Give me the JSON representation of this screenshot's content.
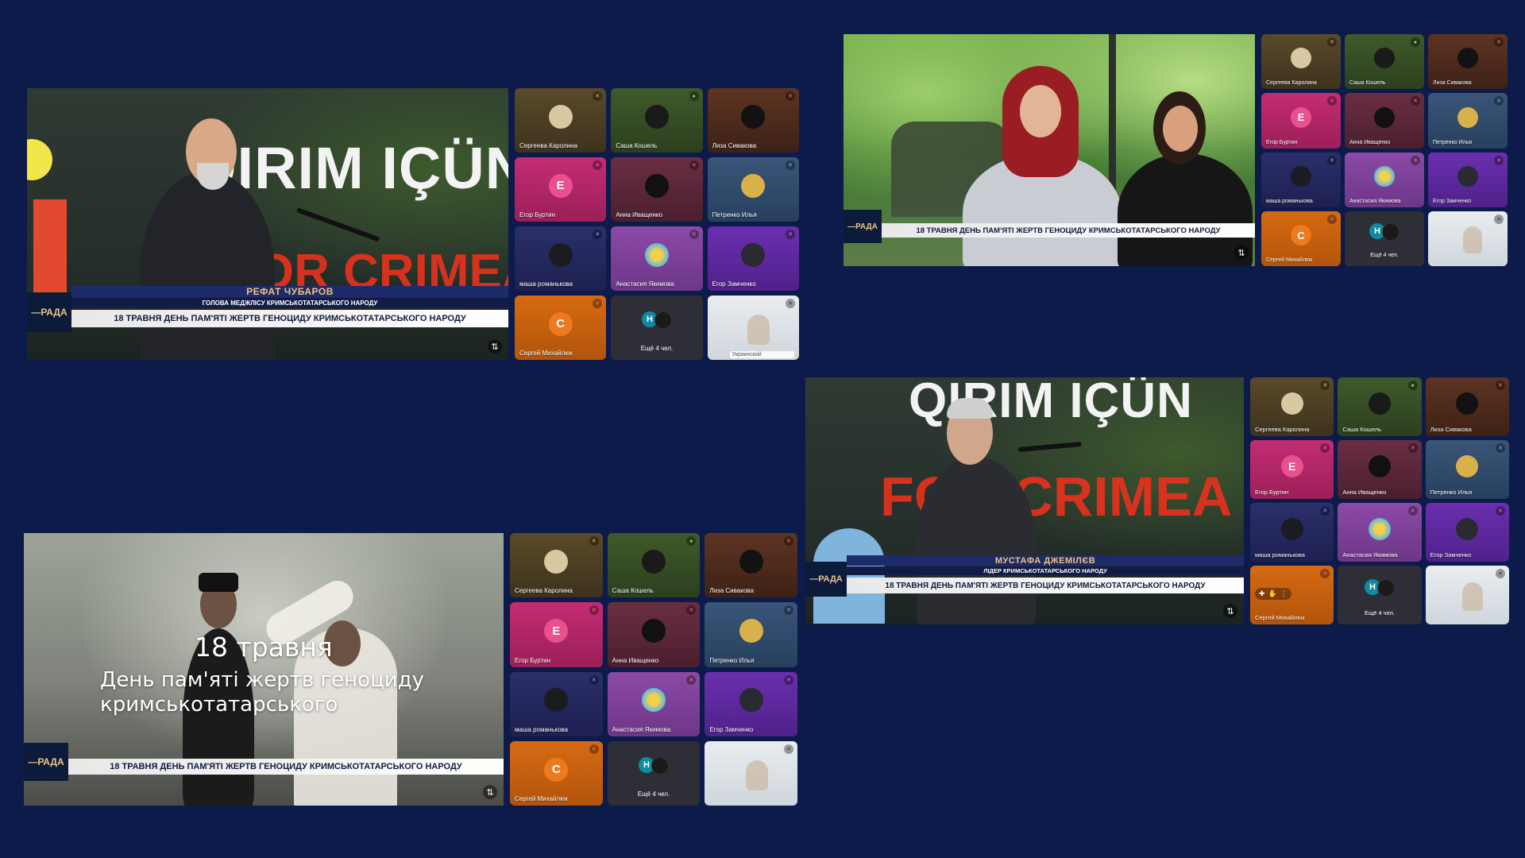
{
  "banner": "18 ТРАВНЯ ДЕНЬ ПАМ'ЯТІ ЖЕРТВ ГЕНОЦИДУ КРИМСЬКОТАТАРСЬКОГО НАРОДУ",
  "channel_logo": "—РАДА",
  "stage_slogan": "QIRIM IÇÜN",
  "stage_slogan2": "FOR CRIMEA",
  "shot1": {
    "speaker_name": "РЕФАТ ЧУБАРОВ",
    "speaker_role": "ГОЛОВА МЕДЖЛІСУ КРИМСЬКОТАТАРСЬКОГО НАРОДУ"
  },
  "shot3": {
    "speaker_name": "МУСТАФА ДЖЕМІЛЄВ",
    "speaker_role": "ЛІДЕР КРИМСЬКОТАТАРСЬКОГО НАРОДУ"
  },
  "shot4": {
    "title_line1": "18 травня",
    "title_line2": "День пам'яті жертв геноциду",
    "title_line3": "кримськотатарського"
  },
  "participants": [
    {
      "name": "Сергеева Каролина",
      "avatar": "photo",
      "style": "t-brown",
      "mic": "muted-yellow"
    },
    {
      "name": "Саша Кошель",
      "avatar": "photo",
      "style": "t-olive",
      "mic": "on"
    },
    {
      "name": "Лиза Сивакова",
      "avatar": "photo",
      "style": "t-rust",
      "mic": "muted"
    },
    {
      "name": "Егор Буртин",
      "avatar": "E",
      "style": "t-pink",
      "mic": "muted"
    },
    {
      "name": "Анна Иващенко",
      "avatar": "photo",
      "style": "t-wine",
      "mic": "muted"
    },
    {
      "name": "Петренко Илья",
      "avatar": "photo",
      "style": "t-steel",
      "mic": "blue"
    },
    {
      "name": "маша романькова",
      "avatar": "photo",
      "style": "t-navy",
      "mic": "blue"
    },
    {
      "name": "Анастасия Якимова",
      "avatar": "photo",
      "style": "t-violet",
      "mic": "muted"
    },
    {
      "name": "Егор Замченко",
      "avatar": "photo",
      "style": "t-purple",
      "mic": "muted"
    },
    {
      "name": "Сергей Михайлюк",
      "avatar": "C",
      "style": "t-orange",
      "mic": "muted"
    }
  ],
  "more_label": "Ещё 4 чел.",
  "more_avatar_letter": "H",
  "self_subtitle": "Украинский",
  "colors": {
    "background": "#0c1b4a",
    "banner_text": "#101a40",
    "name_bar": "#1d2b6b",
    "name_text": "#f2c27a"
  }
}
